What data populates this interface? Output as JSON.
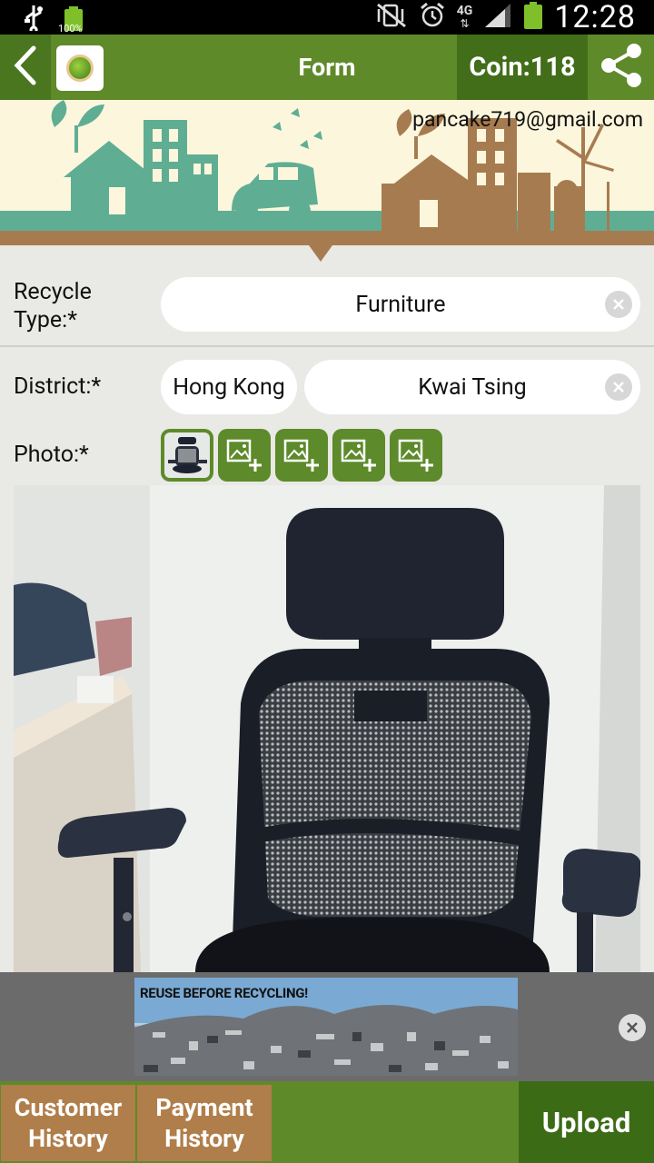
{
  "status_bar": {
    "time": "12:28",
    "battery_small_pct": "100%",
    "network": "4G",
    "icons": [
      "usb-icon",
      "battery-full-icon",
      "muted-vibrate-icon",
      "alarm-icon",
      "network-4g-icon",
      "signal-icon",
      "battery-icon"
    ]
  },
  "app_bar": {
    "title": "Form",
    "coin": "Coin:118",
    "icons": [
      "back-arrow-icon",
      "app-logo-icon",
      "share-icon"
    ]
  },
  "banner": {
    "email": "pancake719@gmail.com"
  },
  "form": {
    "recycle_type_label": "Recycle Type:*",
    "recycle_type_value": "Furniture",
    "district_label": "District:*",
    "district_region": "Hong Kong",
    "district_area": "Kwai Tsing",
    "photo_label": "Photo:*",
    "photo_slots_empty": 4
  },
  "ad": {
    "text": "REUSE BEFORE RECYCLING!"
  },
  "bottom_bar": {
    "customer_history": "Customer History",
    "payment_history": "Payment History",
    "upload": "Upload"
  },
  "colors": {
    "primary_green": "#5f8a2a",
    "dark_green": "#3b6b15",
    "brown": "#b07e4a",
    "banner_bg": "#fbf6dc",
    "banner_teal": "#5fae93"
  }
}
